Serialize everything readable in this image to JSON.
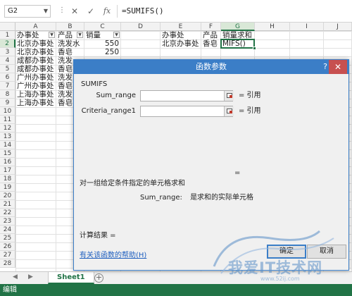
{
  "formula_bar": {
    "name_box": "G2",
    "formula": "=SUMIFS()"
  },
  "columns": [
    "A",
    "B",
    "C",
    "D",
    "E",
    "F",
    "G",
    "H",
    "I",
    "J"
  ],
  "rows": [
    "1",
    "2",
    "3",
    "4",
    "5",
    "6",
    "7",
    "8",
    "9",
    "10",
    "11",
    "12",
    "13",
    "14",
    "15",
    "16",
    "17",
    "18",
    "19",
    "20",
    "21",
    "22",
    "23",
    "24",
    "25",
    "26",
    "27",
    "28"
  ],
  "cells": {
    "A1": "办事处",
    "B1": "产品",
    "C1": "销量",
    "E1": "办事处",
    "F1": "产品",
    "G1": "销量求和",
    "A2": "北京办事处",
    "B2": "洗发水",
    "C2": "550",
    "E2": "北京办事处",
    "F2": "香皂",
    "G2": "MIFS()",
    "A3": "北京办事处",
    "B3": "香皂",
    "C3": "250",
    "A4": "成都办事处",
    "B4": "洗发",
    "A5": "成都办事处",
    "B5": "香皂",
    "A6": "广州办事处",
    "B6": "洗发",
    "A7": "广州办事处",
    "B7": "香皂",
    "A8": "上海办事处",
    "B8": "洗发",
    "A9": "上海办事处",
    "B9": "香皂"
  },
  "sheet_tabs": [
    "Sheet1"
  ],
  "status_bar": {
    "mode": "编辑"
  },
  "dialog": {
    "title": "函数参数",
    "function_name": "SUMIFS",
    "args": [
      {
        "label": "Sum_range",
        "result": "= 引用"
      },
      {
        "label": "Criteria_range1",
        "result": "= 引用"
      }
    ],
    "equals": "=",
    "description": "对一组给定条件指定的单元格求和",
    "arg_name": "Sum_range:",
    "arg_description": "是求和的实际单元格",
    "calc_result": "计算结果 =",
    "help_link": "有关该函数的帮助(H)",
    "ok_label": "确定",
    "cancel_label": "取消"
  },
  "watermark": {
    "text": "我爱IT技术网",
    "url": "www.52ij.com"
  }
}
